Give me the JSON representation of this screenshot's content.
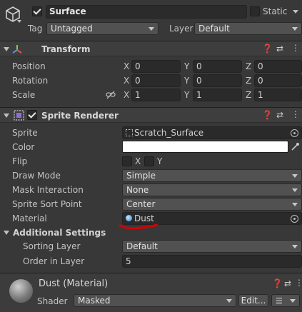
{
  "header": {
    "object_name": "Surface",
    "active": true,
    "static_label": "Static",
    "static_checked": false,
    "tag_label": "Tag",
    "tag_value": "Untagged",
    "layer_label": "Layer",
    "layer_value": "Default"
  },
  "transform": {
    "title": "Transform",
    "position": {
      "label": "Position",
      "x": "0",
      "y": "0",
      "z": "0"
    },
    "rotation": {
      "label": "Rotation",
      "x": "0",
      "y": "0",
      "z": "0"
    },
    "scale": {
      "label": "Scale",
      "x": "1",
      "y": "1",
      "z": "1"
    },
    "axis_x": "X",
    "axis_y": "Y",
    "axis_z": "Z"
  },
  "sprite_renderer": {
    "title": "Sprite Renderer",
    "enabled": true,
    "sprite_label": "Sprite",
    "sprite_value": "Scratch_Surface",
    "color_label": "Color",
    "color_value": "#ffffff",
    "flip_label": "Flip",
    "flip_x_label": "X",
    "flip_y_label": "Y",
    "draw_mode_label": "Draw Mode",
    "draw_mode_value": "Simple",
    "mask_label": "Mask Interaction",
    "mask_value": "None",
    "sort_point_label": "Sprite Sort Point",
    "sort_point_value": "Center",
    "material_label": "Material",
    "material_value": "Dust",
    "additional_label": "Additional Settings",
    "sorting_layer_label": "Sorting Layer",
    "sorting_layer_value": "Default",
    "order_label": "Order in Layer",
    "order_value": "5"
  },
  "material": {
    "title": "Dust (Material)",
    "shader_label": "Shader",
    "shader_value": "Masked",
    "edit_label": "Edit..."
  },
  "annotation_color": "#d40000"
}
